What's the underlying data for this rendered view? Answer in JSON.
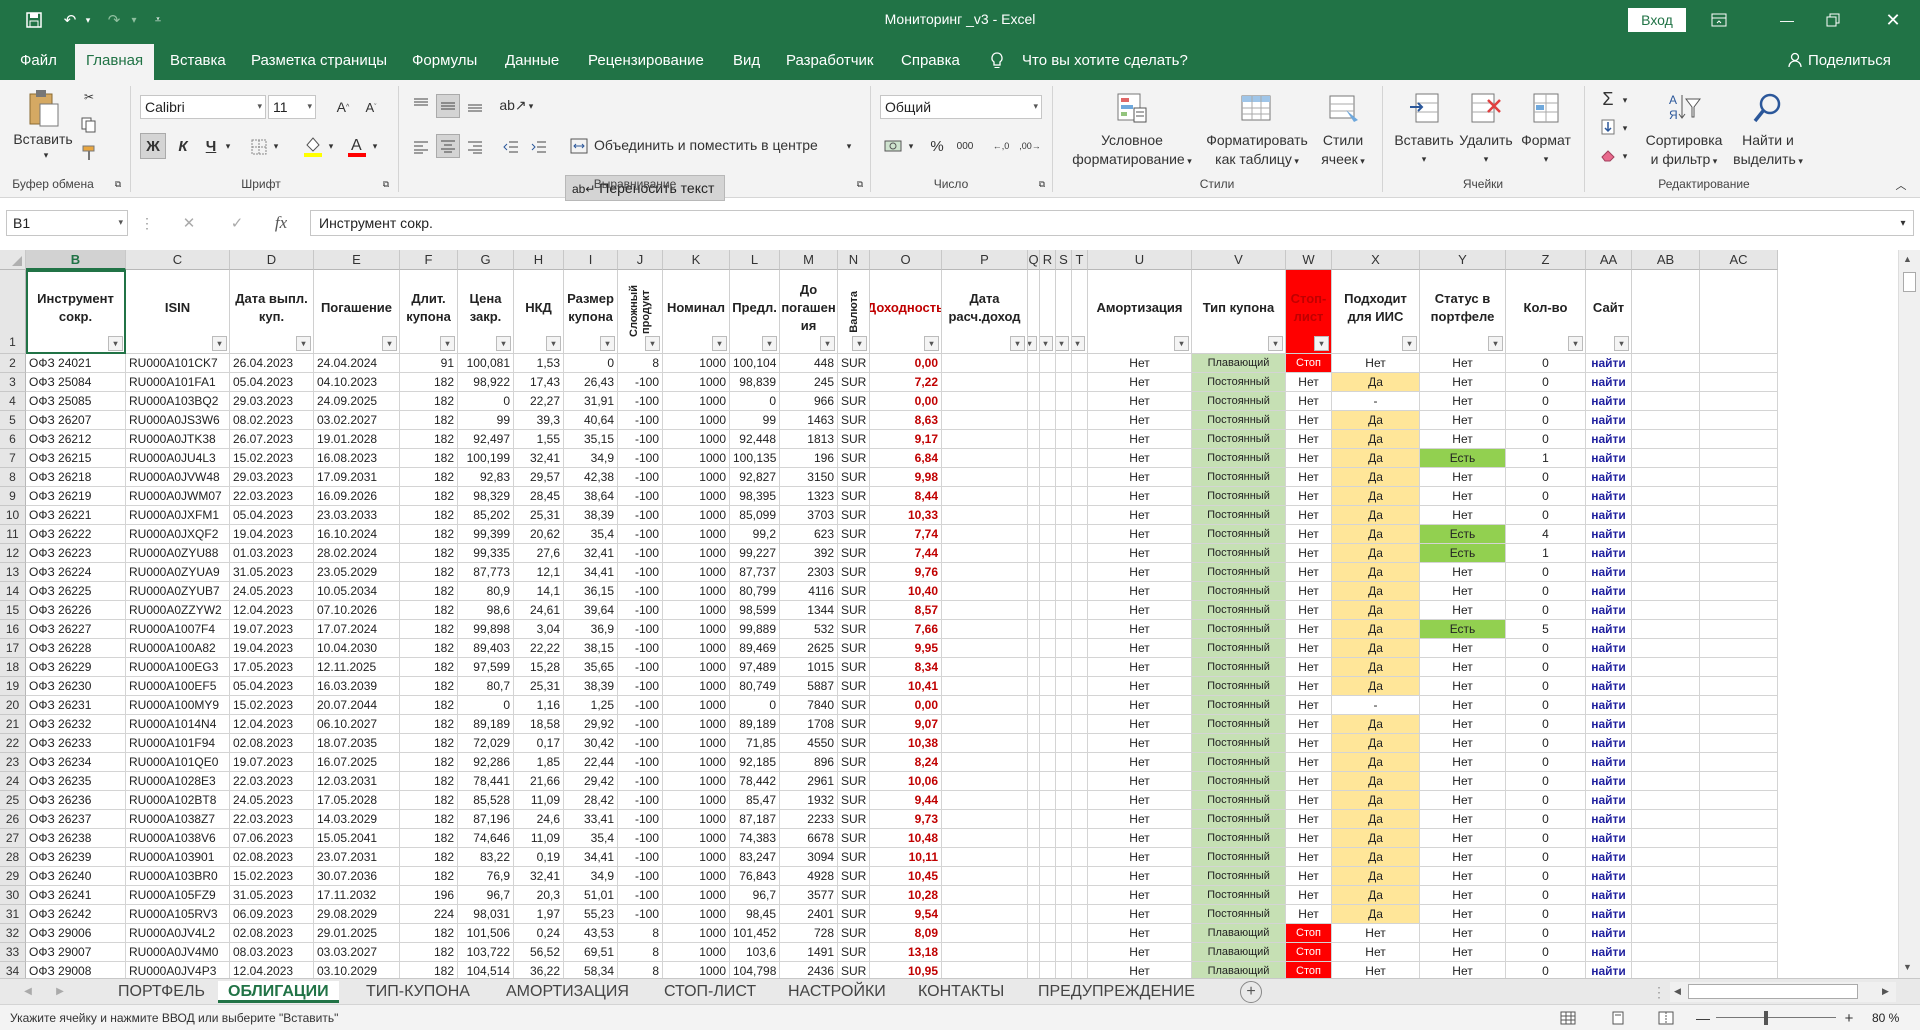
{
  "app": {
    "title": "Мониторинг _v3  -  Excel",
    "login": "Вход"
  },
  "menu_tabs": [
    "Файл",
    "Главная",
    "Вставка",
    "Разметка страницы",
    "Формулы",
    "Данные",
    "Рецензирование",
    "Вид",
    "Разработчик",
    "Справка",
    "Что вы хотите сделать?"
  ],
  "share": "Поделиться",
  "ribbon": {
    "paste": "Вставить",
    "clipboard": "Буфер обмена",
    "font_name": "Calibri",
    "font_size": "11",
    "font_group": "Шрифт",
    "bold": "Ж",
    "italic": "К",
    "underline": "Ч",
    "wrap_text": "Переносить текст",
    "merge_center": "Объединить и поместить в центре",
    "align_group": "Выравнивание",
    "number_format": "Общий",
    "number_group": "Число",
    "cond_format": [
      "Условное",
      "форматирование"
    ],
    "format_table": [
      "Форматировать",
      "как таблицу"
    ],
    "cell_styles": [
      "Стили",
      "ячеек"
    ],
    "styles_group": "Стили",
    "insert": "Вставить",
    "delete": "Удалить",
    "format": "Формат",
    "cells_group": "Ячейки",
    "sort_filter": [
      "Сортировка",
      "и фильтр"
    ],
    "find_select": [
      "Найти и",
      "выделить"
    ],
    "edit_group": "Редактирование"
  },
  "formula": {
    "cell_ref": "B1",
    "content": "Инструмент сокр."
  },
  "columns": [
    "B",
    "C",
    "D",
    "E",
    "F",
    "G",
    "H",
    "I",
    "J",
    "K",
    "L",
    "M",
    "N",
    "O",
    "P",
    "Q",
    "R",
    "S",
    "T",
    "U",
    "V",
    "W",
    "X",
    "Y",
    "Z",
    "AA",
    "AB",
    "AC"
  ],
  "headers": {
    "B": "Инструмент сокр.",
    "C": "ISIN",
    "D": "Дата выпл. куп.",
    "E": "Погашение",
    "F": "Длит. купона",
    "G": "Цена закр.",
    "H": "НКД",
    "I": "Размер купона",
    "J": "Сложный продукт",
    "K": "Номинал",
    "L": "Предл.",
    "M": "До погашен ия",
    "N": "Валюта",
    "O": "Доходность",
    "P": "Дата расч.доход",
    "U": "Амортизация",
    "V": "Тип купона",
    "W": "Стоп-лист",
    "X": "Подходит для ИИС",
    "Y": "Статус в портфеле",
    "Z": "Кол-во",
    "AA": "Сайт"
  },
  "rows": [
    [
      "2",
      "ОФЗ 24021",
      "RU000A101CK7",
      "26.04.2023",
      "24.04.2024",
      "91",
      "100,081",
      "1,53",
      "0",
      "8",
      "1000",
      "100,104",
      "448",
      "SUR",
      "0,00",
      "Нет",
      "Плавающий",
      "Стоп",
      "Нет",
      "Нет",
      "0",
      "найти"
    ],
    [
      "3",
      "ОФЗ 25084",
      "RU000A101FA1",
      "05.04.2023",
      "04.10.2023",
      "182",
      "98,922",
      "17,43",
      "26,43",
      "-100",
      "1000",
      "98,839",
      "245",
      "SUR",
      "7,22",
      "Нет",
      "Постоянный",
      "Нет",
      "Да",
      "Нет",
      "0",
      "найти"
    ],
    [
      "4",
      "ОФЗ 25085",
      "RU000A103BQ2",
      "29.03.2023",
      "24.09.2025",
      "182",
      "0",
      "22,27",
      "31,91",
      "-100",
      "1000",
      "0",
      "966",
      "SUR",
      "0,00",
      "Нет",
      "Постоянный",
      "Нет",
      "-",
      "Нет",
      "0",
      "найти"
    ],
    [
      "5",
      "ОФЗ 26207",
      "RU000A0JS3W6",
      "08.02.2023",
      "03.02.2027",
      "182",
      "99",
      "39,3",
      "40,64",
      "-100",
      "1000",
      "99",
      "1463",
      "SUR",
      "8,63",
      "Нет",
      "Постоянный",
      "Нет",
      "Да",
      "Нет",
      "0",
      "найти"
    ],
    [
      "6",
      "ОФЗ 26212",
      "RU000A0JTK38",
      "26.07.2023",
      "19.01.2028",
      "182",
      "92,497",
      "1,55",
      "35,15",
      "-100",
      "1000",
      "92,448",
      "1813",
      "SUR",
      "9,17",
      "Нет",
      "Постоянный",
      "Нет",
      "Да",
      "Нет",
      "0",
      "найти"
    ],
    [
      "7",
      "ОФЗ 26215",
      "RU000A0JU4L3",
      "15.02.2023",
      "16.08.2023",
      "182",
      "100,199",
      "32,41",
      "34,9",
      "-100",
      "1000",
      "100,135",
      "196",
      "SUR",
      "6,84",
      "Нет",
      "Постоянный",
      "Нет",
      "Да",
      "Есть",
      "1",
      "найти"
    ],
    [
      "8",
      "ОФЗ 26218",
      "RU000A0JVW48",
      "29.03.2023",
      "17.09.2031",
      "182",
      "92,83",
      "29,57",
      "42,38",
      "-100",
      "1000",
      "92,827",
      "3150",
      "SUR",
      "9,98",
      "Нет",
      "Постоянный",
      "Нет",
      "Да",
      "Нет",
      "0",
      "найти"
    ],
    [
      "9",
      "ОФЗ 26219",
      "RU000A0JWM07",
      "22.03.2023",
      "16.09.2026",
      "182",
      "98,329",
      "28,45",
      "38,64",
      "-100",
      "1000",
      "98,395",
      "1323",
      "SUR",
      "8,44",
      "Нет",
      "Постоянный",
      "Нет",
      "Да",
      "Нет",
      "0",
      "найти"
    ],
    [
      "10",
      "ОФЗ 26221",
      "RU000A0JXFM1",
      "05.04.2023",
      "23.03.2033",
      "182",
      "85,202",
      "25,31",
      "38,39",
      "-100",
      "1000",
      "85,099",
      "3703",
      "SUR",
      "10,33",
      "Нет",
      "Постоянный",
      "Нет",
      "Да",
      "Нет",
      "0",
      "найти"
    ],
    [
      "11",
      "ОФЗ 26222",
      "RU000A0JXQF2",
      "19.04.2023",
      "16.10.2024",
      "182",
      "99,399",
      "20,62",
      "35,4",
      "-100",
      "1000",
      "99,2",
      "623",
      "SUR",
      "7,74",
      "Нет",
      "Постоянный",
      "Нет",
      "Да",
      "Есть",
      "4",
      "найти"
    ],
    [
      "12",
      "ОФЗ 26223",
      "RU000A0ZYU88",
      "01.03.2023",
      "28.02.2024",
      "182",
      "99,335",
      "27,6",
      "32,41",
      "-100",
      "1000",
      "99,227",
      "392",
      "SUR",
      "7,44",
      "Нет",
      "Постоянный",
      "Нет",
      "Да",
      "Есть",
      "1",
      "найти"
    ],
    [
      "13",
      "ОФЗ 26224",
      "RU000A0ZYUA9",
      "31.05.2023",
      "23.05.2029",
      "182",
      "87,773",
      "12,1",
      "34,41",
      "-100",
      "1000",
      "87,737",
      "2303",
      "SUR",
      "9,76",
      "Нет",
      "Постоянный",
      "Нет",
      "Да",
      "Нет",
      "0",
      "найти"
    ],
    [
      "14",
      "ОФЗ 26225",
      "RU000A0ZYUB7",
      "24.05.2023",
      "10.05.2034",
      "182",
      "80,9",
      "14,1",
      "36,15",
      "-100",
      "1000",
      "80,799",
      "4116",
      "SUR",
      "10,40",
      "Нет",
      "Постоянный",
      "Нет",
      "Да",
      "Нет",
      "0",
      "найти"
    ],
    [
      "15",
      "ОФЗ 26226",
      "RU000A0ZZYW2",
      "12.04.2023",
      "07.10.2026",
      "182",
      "98,6",
      "24,61",
      "39,64",
      "-100",
      "1000",
      "98,599",
      "1344",
      "SUR",
      "8,57",
      "Нет",
      "Постоянный",
      "Нет",
      "Да",
      "Нет",
      "0",
      "найти"
    ],
    [
      "16",
      "ОФЗ 26227",
      "RU000A1007F4",
      "19.07.2023",
      "17.07.2024",
      "182",
      "99,898",
      "3,04",
      "36,9",
      "-100",
      "1000",
      "99,889",
      "532",
      "SUR",
      "7,66",
      "Нет",
      "Постоянный",
      "Нет",
      "Да",
      "Есть",
      "5",
      "найти"
    ],
    [
      "17",
      "ОФЗ 26228",
      "RU000A100A82",
      "19.04.2023",
      "10.04.2030",
      "182",
      "89,403",
      "22,22",
      "38,15",
      "-100",
      "1000",
      "89,469",
      "2625",
      "SUR",
      "9,95",
      "Нет",
      "Постоянный",
      "Нет",
      "Да",
      "Нет",
      "0",
      "найти"
    ],
    [
      "18",
      "ОФЗ 26229",
      "RU000A100EG3",
      "17.05.2023",
      "12.11.2025",
      "182",
      "97,599",
      "15,28",
      "35,65",
      "-100",
      "1000",
      "97,489",
      "1015",
      "SUR",
      "8,34",
      "Нет",
      "Постоянный",
      "Нет",
      "Да",
      "Нет",
      "0",
      "найти"
    ],
    [
      "19",
      "ОФЗ 26230",
      "RU000A100EF5",
      "05.04.2023",
      "16.03.2039",
      "182",
      "80,7",
      "25,31",
      "38,39",
      "-100",
      "1000",
      "80,749",
      "5887",
      "SUR",
      "10,41",
      "Нет",
      "Постоянный",
      "Нет",
      "Да",
      "Нет",
      "0",
      "найти"
    ],
    [
      "20",
      "ОФЗ 26231",
      "RU000A100MY9",
      "15.02.2023",
      "20.07.2044",
      "182",
      "0",
      "1,16",
      "1,25",
      "-100",
      "1000",
      "0",
      "7840",
      "SUR",
      "0,00",
      "Нет",
      "Постоянный",
      "Нет",
      "-",
      "Нет",
      "0",
      "найти"
    ],
    [
      "21",
      "ОФЗ 26232",
      "RU000A1014N4",
      "12.04.2023",
      "06.10.2027",
      "182",
      "89,189",
      "18,58",
      "29,92",
      "-100",
      "1000",
      "89,189",
      "1708",
      "SUR",
      "9,07",
      "Нет",
      "Постоянный",
      "Нет",
      "Да",
      "Нет",
      "0",
      "найти"
    ],
    [
      "22",
      "ОФЗ 26233",
      "RU000A101F94",
      "02.08.2023",
      "18.07.2035",
      "182",
      "72,029",
      "0,17",
      "30,42",
      "-100",
      "1000",
      "71,85",
      "4550",
      "SUR",
      "10,38",
      "Нет",
      "Постоянный",
      "Нет",
      "Да",
      "Нет",
      "0",
      "найти"
    ],
    [
      "23",
      "ОФЗ 26234",
      "RU000A101QE0",
      "19.07.2023",
      "16.07.2025",
      "182",
      "92,286",
      "1,85",
      "22,44",
      "-100",
      "1000",
      "92,185",
      "896",
      "SUR",
      "8,24",
      "Нет",
      "Постоянный",
      "Нет",
      "Да",
      "Нет",
      "0",
      "найти"
    ],
    [
      "24",
      "ОФЗ 26235",
      "RU000A1028E3",
      "22.03.2023",
      "12.03.2031",
      "182",
      "78,441",
      "21,66",
      "29,42",
      "-100",
      "1000",
      "78,442",
      "2961",
      "SUR",
      "10,06",
      "Нет",
      "Постоянный",
      "Нет",
      "Да",
      "Нет",
      "0",
      "найти"
    ],
    [
      "25",
      "ОФЗ 26236",
      "RU000A102BT8",
      "24.05.2023",
      "17.05.2028",
      "182",
      "85,528",
      "11,09",
      "28,42",
      "-100",
      "1000",
      "85,47",
      "1932",
      "SUR",
      "9,44",
      "Нет",
      "Постоянный",
      "Нет",
      "Да",
      "Нет",
      "0",
      "найти"
    ],
    [
      "26",
      "ОФЗ 26237",
      "RU000A1038Z7",
      "22.03.2023",
      "14.03.2029",
      "182",
      "87,196",
      "24,6",
      "33,41",
      "-100",
      "1000",
      "87,187",
      "2233",
      "SUR",
      "9,73",
      "Нет",
      "Постоянный",
      "Нет",
      "Да",
      "Нет",
      "0",
      "найти"
    ],
    [
      "27",
      "ОФЗ 26238",
      "RU000A1038V6",
      "07.06.2023",
      "15.05.2041",
      "182",
      "74,646",
      "11,09",
      "35,4",
      "-100",
      "1000",
      "74,383",
      "6678",
      "SUR",
      "10,48",
      "Нет",
      "Постоянный",
      "Нет",
      "Да",
      "Нет",
      "0",
      "найти"
    ],
    [
      "28",
      "ОФЗ 26239",
      "RU000A103901",
      "02.08.2023",
      "23.07.2031",
      "182",
      "83,22",
      "0,19",
      "34,41",
      "-100",
      "1000",
      "83,247",
      "3094",
      "SUR",
      "10,11",
      "Нет",
      "Постоянный",
      "Нет",
      "Да",
      "Нет",
      "0",
      "найти"
    ],
    [
      "29",
      "ОФЗ 26240",
      "RU000A103BR0",
      "15.02.2023",
      "30.07.2036",
      "182",
      "76,9",
      "32,41",
      "34,9",
      "-100",
      "1000",
      "76,843",
      "4928",
      "SUR",
      "10,45",
      "Нет",
      "Постоянный",
      "Нет",
      "Да",
      "Нет",
      "0",
      "найти"
    ],
    [
      "30",
      "ОФЗ 26241",
      "RU000A105FZ9",
      "31.05.2023",
      "17.11.2032",
      "196",
      "96,7",
      "20,3",
      "51,01",
      "-100",
      "1000",
      "96,7",
      "3577",
      "SUR",
      "10,28",
      "Нет",
      "Постоянный",
      "Нет",
      "Да",
      "Нет",
      "0",
      "найти"
    ],
    [
      "31",
      "ОФЗ 26242",
      "RU000A105RV3",
      "06.09.2023",
      "29.08.2029",
      "224",
      "98,031",
      "1,97",
      "55,23",
      "-100",
      "1000",
      "98,45",
      "2401",
      "SUR",
      "9,54",
      "Нет",
      "Постоянный",
      "Нет",
      "Да",
      "Нет",
      "0",
      "найти"
    ],
    [
      "32",
      "ОФЗ 29006",
      "RU000A0JV4L2",
      "02.08.2023",
      "29.01.2025",
      "182",
      "101,506",
      "0,24",
      "43,53",
      "8",
      "1000",
      "101,452",
      "728",
      "SUR",
      "8,09",
      "Нет",
      "Плавающий",
      "Стоп",
      "Нет",
      "Нет",
      "0",
      "найти"
    ],
    [
      "33",
      "ОФЗ 29007",
      "RU000A0JV4M0",
      "08.03.2023",
      "03.03.2027",
      "182",
      "103,722",
      "56,52",
      "69,51",
      "8",
      "1000",
      "103,6",
      "1491",
      "SUR",
      "13,18",
      "Нет",
      "Плавающий",
      "Стоп",
      "Нет",
      "Нет",
      "0",
      "найти"
    ],
    [
      "34",
      "ОФЗ 29008",
      "RU000A0JV4P3",
      "12.04.2023",
      "03.10.2029",
      "182",
      "104,514",
      "36,22",
      "58,34",
      "8",
      "1000",
      "104,798",
      "2436",
      "SUR",
      "10,95",
      "Нет",
      "Плавающий",
      "Стоп",
      "Нет",
      "Нет",
      "0",
      "найти"
    ]
  ],
  "sheet_tabs": [
    "ПОРТФЕЛЬ",
    "ОБЛИГАЦИИ",
    "ТИП-КУПОНА",
    "АМОРТИЗАЦИЯ",
    "СТОП-ЛИСТ",
    "НАСТРОЙКИ",
    "КОНТАКТЫ",
    "ПРЕДУПРЕЖДЕНИЕ"
  ],
  "status": {
    "message": "Укажите ячейку и нажмите ВВОД или выберите \"Вставить\"",
    "zoom": "80 %"
  }
}
